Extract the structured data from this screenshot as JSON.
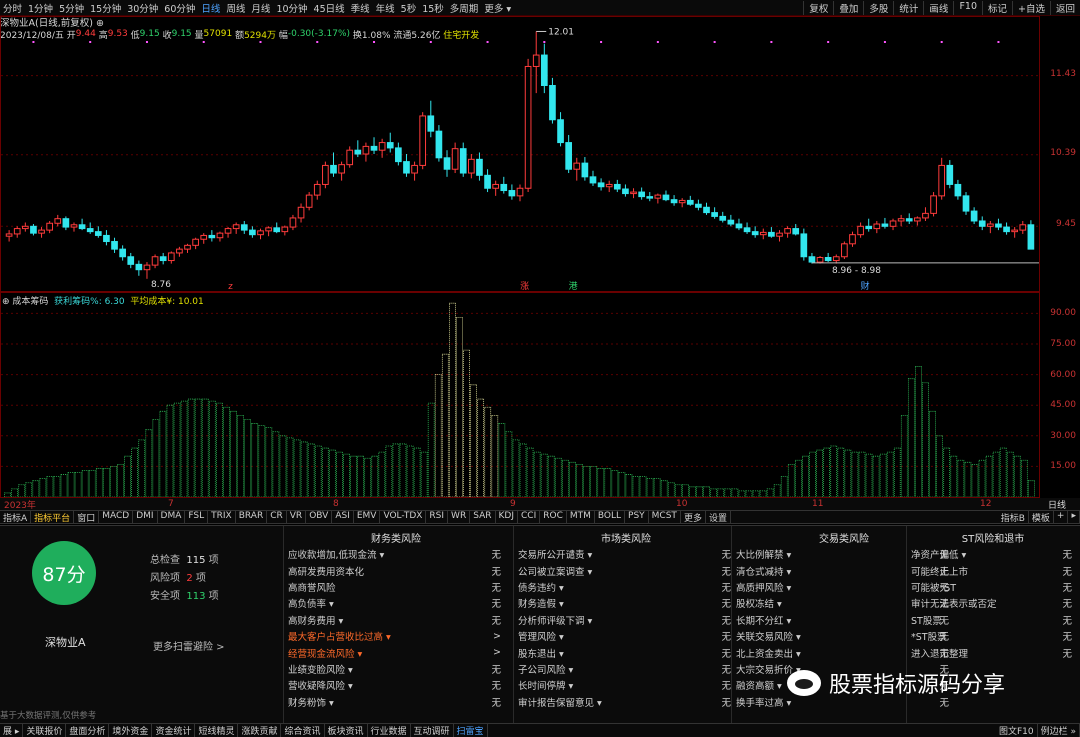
{
  "topbar": {
    "periods": [
      "分时",
      "1分钟",
      "5分钟",
      "15分钟",
      "30分钟",
      "60分钟",
      "日线",
      "周线",
      "月线",
      "10分钟",
      "45日线",
      "季线",
      "年线",
      "5秒",
      "15秒",
      "多周期",
      "更多 ▾"
    ],
    "active_index": 6,
    "tools": [
      "复权",
      "叠加",
      "多股",
      "统计",
      "画线",
      "F10",
      "标记",
      "+自选",
      "返回"
    ]
  },
  "info": {
    "title": "深物业A(日线,前复权) ⊕",
    "date": "2023/12/08/五",
    "open_label": "开",
    "open": "9.44",
    "high_label": "高",
    "high": "9.53",
    "low_label": "低",
    "low": "9.15",
    "close_label": "收",
    "close": "9.15",
    "vol_label": "量",
    "vol": "57091",
    "amount_label": "额",
    "amount": "5294万",
    "chg_label": "幅",
    "chg": "-0.30(-3.17%)",
    "turnover": "换1.08%",
    "float_cap": "流通5.26亿",
    "sector": "住宅开发"
  },
  "price_axis": [
    "11.43",
    "10.39",
    "9.45"
  ],
  "price_annotations": {
    "high": "12.01",
    "low": "8.76",
    "range": "8.96 - 8.98"
  },
  "markers": {
    "zhang": "涨",
    "gang": "港",
    "cai": "财",
    "z": "z"
  },
  "chip": {
    "title": "⊕ 成本筹码",
    "profit": "获利筹码%: 6.30",
    "avg_cost": "平均成本¥: 10.01",
    "axis": [
      "90.00",
      "75.00",
      "60.00",
      "45.00",
      "30.00",
      "15.00"
    ]
  },
  "time_axis": {
    "labels": [
      "2023年",
      "7",
      "8",
      "9",
      "10",
      "11",
      "12"
    ],
    "right": "日线"
  },
  "tabbar": {
    "items": [
      "指标A",
      "指标平台",
      "窗口",
      "MACD",
      "DMI",
      "DMA",
      "FSL",
      "TRIX",
      "BRAR",
      "CR",
      "VR",
      "OBV",
      "ASI",
      "EMV",
      "VOL-TDX",
      "RSI",
      "WR",
      "SAR",
      "KDJ",
      "CCI",
      "ROC",
      "MTM",
      "BOLL",
      "PSY",
      "MCST",
      "更多",
      "设置"
    ],
    "active_index": 1,
    "right": [
      "指标B",
      "模板",
      "+",
      "▸"
    ]
  },
  "risk": {
    "score": "87分",
    "stock_name": "深物业A",
    "total_label": "总检查",
    "total_value": "115",
    "unit": "项",
    "risk_label": "风险项",
    "risk_value": "2",
    "safe_label": "安全项",
    "safe_value": "113",
    "more_scan": "更多扫雷避险 >",
    "disclaimer": "基于大数据评测,仅供参考",
    "columns": [
      {
        "title": "财务类风险",
        "rows": [
          {
            "label": "应收款增加,低现金流 ▾",
            "value": "无"
          },
          {
            "label": "高研发费用资本化",
            "value": "无"
          },
          {
            "label": "高商誉风险",
            "value": "无"
          },
          {
            "label": "高负债率 ▾",
            "value": "无"
          },
          {
            "label": "高财务费用 ▾",
            "value": "无"
          },
          {
            "label": "最大客户占营收比过高 ▾",
            "value": ">",
            "hot": true
          },
          {
            "label": "经营现金流风险 ▾",
            "value": ">",
            "hot": true
          },
          {
            "label": "业绩变脸风险 ▾",
            "value": "无"
          },
          {
            "label": "营收疑降风险 ▾",
            "value": "无"
          },
          {
            "label": "财务粉饰 ▾",
            "value": "无"
          }
        ]
      },
      {
        "title": "市场类风险",
        "rows": [
          {
            "label": "交易所公开谴责 ▾",
            "value": "无"
          },
          {
            "label": "公司被立案调查 ▾",
            "value": "无"
          },
          {
            "label": "债务违约 ▾",
            "value": "无"
          },
          {
            "label": "财务造假 ▾",
            "value": "无"
          },
          {
            "label": "分析师评级下调 ▾",
            "value": "无"
          },
          {
            "label": "管理风险 ▾",
            "value": "无"
          },
          {
            "label": "股东退出 ▾",
            "value": "无"
          },
          {
            "label": "子公司风险 ▾",
            "value": "无"
          },
          {
            "label": "长时间停牌 ▾",
            "value": "无"
          },
          {
            "label": "审计报告保留意见 ▾",
            "value": "无"
          }
        ]
      },
      {
        "title": "交易类风险",
        "rows": [
          {
            "label": "大比例解禁 ▾",
            "value": "无"
          },
          {
            "label": "清仓式减持 ▾",
            "value": "无"
          },
          {
            "label": "高质押风险 ▾",
            "value": "无"
          },
          {
            "label": "股权冻结 ▾",
            "value": "无"
          },
          {
            "label": "长期不分红 ▾",
            "value": "无"
          },
          {
            "label": "关联交易风险 ▾",
            "value": "无"
          },
          {
            "label": "北上资金卖出 ▾",
            "value": "无"
          },
          {
            "label": "大宗交易折价 ▾",
            "value": "无"
          },
          {
            "label": "融资高额 ▾",
            "value": "无"
          },
          {
            "label": "换手率过高 ▾",
            "value": "无"
          }
        ]
      },
      {
        "title": "ST风险和退市",
        "rows": [
          {
            "label": "净资产偏低 ▾",
            "value": "无"
          },
          {
            "label": "可能终止上市",
            "value": "无"
          },
          {
            "label": "可能被*ST",
            "value": "无"
          },
          {
            "label": "审计无法表示或否定",
            "value": "无"
          },
          {
            "label": "ST股票",
            "value": "无"
          },
          {
            "label": "*ST股票",
            "value": "无"
          },
          {
            "label": "进入退市整理",
            "value": "无"
          }
        ]
      }
    ]
  },
  "watermark": "股票指标源码分享",
  "bottombar": {
    "items": [
      "展 ▸",
      "关联报价",
      "盘面分析",
      "境外资金",
      "资金统计",
      "短线精灵",
      "涨跌贡献",
      "综合资讯",
      "板块资讯",
      "行业数据",
      "互动调研",
      "扫雷宝"
    ],
    "active_index": 11,
    "right": [
      "图文F10",
      "例边栏 »"
    ]
  },
  "colors": {
    "up": "#ff3c3c",
    "down": "#32e6ee",
    "chip_old": "#2fc35a",
    "chip_new": "#e8e8a0",
    "score": "#1fae5c"
  },
  "chart_data": {
    "type": "candlestick",
    "ylim": [
      8.6,
      12.2
    ],
    "y_ticks": [
      11.43,
      10.39,
      9.45
    ],
    "ohlc": [
      [
        9.32,
        9.4,
        9.25,
        9.35
      ],
      [
        9.35,
        9.45,
        9.3,
        9.42
      ],
      [
        9.42,
        9.5,
        9.38,
        9.45
      ],
      [
        9.45,
        9.48,
        9.33,
        9.36
      ],
      [
        9.36,
        9.44,
        9.3,
        9.4
      ],
      [
        9.4,
        9.52,
        9.36,
        9.49
      ],
      [
        9.49,
        9.6,
        9.45,
        9.55
      ],
      [
        9.55,
        9.58,
        9.4,
        9.44
      ],
      [
        9.44,
        9.5,
        9.38,
        9.47
      ],
      [
        9.47,
        9.55,
        9.4,
        9.42
      ],
      [
        9.42,
        9.5,
        9.35,
        9.38
      ],
      [
        9.38,
        9.45,
        9.3,
        9.33
      ],
      [
        9.33,
        9.4,
        9.2,
        9.25
      ],
      [
        9.25,
        9.3,
        9.1,
        9.15
      ],
      [
        9.15,
        9.2,
        9.0,
        9.05
      ],
      [
        9.05,
        9.1,
        8.9,
        8.95
      ],
      [
        8.95,
        9.0,
        8.8,
        8.88
      ],
      [
        8.88,
        8.98,
        8.76,
        8.94
      ],
      [
        8.94,
        9.08,
        8.9,
        9.05
      ],
      [
        9.05,
        9.1,
        8.95,
        9.0
      ],
      [
        9.0,
        9.12,
        8.96,
        9.1
      ],
      [
        9.1,
        9.18,
        9.05,
        9.15
      ],
      [
        9.15,
        9.22,
        9.1,
        9.2
      ],
      [
        9.2,
        9.3,
        9.15,
        9.28
      ],
      [
        9.28,
        9.36,
        9.22,
        9.33
      ],
      [
        9.33,
        9.4,
        9.25,
        9.3
      ],
      [
        9.3,
        9.38,
        9.25,
        9.36
      ],
      [
        9.36,
        9.44,
        9.3,
        9.42
      ],
      [
        9.42,
        9.5,
        9.35,
        9.47
      ],
      [
        9.47,
        9.52,
        9.35,
        9.4
      ],
      [
        9.4,
        9.45,
        9.3,
        9.34
      ],
      [
        9.34,
        9.42,
        9.28,
        9.39
      ],
      [
        9.39,
        9.45,
        9.32,
        9.43
      ],
      [
        9.43,
        9.5,
        9.36,
        9.38
      ],
      [
        9.38,
        9.46,
        9.33,
        9.44
      ],
      [
        9.44,
        9.6,
        9.4,
        9.56
      ],
      [
        9.56,
        9.75,
        9.5,
        9.7
      ],
      [
        9.7,
        9.9,
        9.66,
        9.86
      ],
      [
        9.86,
        10.05,
        9.8,
        10.0
      ],
      [
        10.0,
        10.3,
        9.95,
        10.25
      ],
      [
        10.25,
        10.42,
        10.1,
        10.15
      ],
      [
        10.15,
        10.3,
        10.05,
        10.26
      ],
      [
        10.26,
        10.5,
        10.22,
        10.45
      ],
      [
        10.45,
        10.58,
        10.36,
        10.4
      ],
      [
        10.4,
        10.55,
        10.3,
        10.5
      ],
      [
        10.5,
        10.62,
        10.4,
        10.45
      ],
      [
        10.45,
        10.6,
        10.35,
        10.55
      ],
      [
        10.55,
        10.68,
        10.42,
        10.48
      ],
      [
        10.48,
        10.55,
        10.25,
        10.3
      ],
      [
        10.3,
        10.4,
        10.1,
        10.15
      ],
      [
        10.15,
        10.3,
        10.05,
        10.25
      ],
      [
        10.25,
        10.95,
        10.2,
        10.9
      ],
      [
        10.9,
        11.1,
        10.62,
        10.7
      ],
      [
        10.7,
        10.78,
        10.3,
        10.35
      ],
      [
        10.35,
        10.45,
        10.1,
        10.2
      ],
      [
        10.2,
        10.55,
        10.15,
        10.47
      ],
      [
        10.47,
        10.55,
        10.1,
        10.15
      ],
      [
        10.15,
        10.4,
        10.08,
        10.33
      ],
      [
        10.33,
        10.42,
        10.05,
        10.12
      ],
      [
        10.12,
        10.2,
        9.9,
        9.95
      ],
      [
        9.95,
        10.05,
        9.85,
        10.0
      ],
      [
        10.0,
        10.1,
        9.88,
        9.92
      ],
      [
        9.92,
        10.0,
        9.8,
        9.85
      ],
      [
        9.85,
        10.0,
        9.78,
        9.95
      ],
      [
        9.95,
        11.65,
        9.9,
        11.55
      ],
      [
        11.55,
        12.01,
        11.2,
        11.7
      ],
      [
        11.7,
        11.85,
        11.2,
        11.3
      ],
      [
        11.3,
        11.4,
        10.8,
        10.85
      ],
      [
        10.85,
        10.95,
        10.5,
        10.55
      ],
      [
        10.55,
        10.65,
        10.15,
        10.2
      ],
      [
        10.2,
        10.35,
        10.05,
        10.28
      ],
      [
        10.28,
        10.36,
        10.05,
        10.1
      ],
      [
        10.1,
        10.18,
        9.98,
        10.02
      ],
      [
        10.02,
        10.08,
        9.92,
        9.97
      ],
      [
        9.97,
        10.05,
        9.9,
        10.0
      ],
      [
        10.0,
        10.06,
        9.9,
        9.94
      ],
      [
        9.94,
        10.0,
        9.84,
        9.88
      ],
      [
        9.88,
        9.95,
        9.82,
        9.9
      ],
      [
        9.9,
        9.96,
        9.8,
        9.84
      ],
      [
        9.84,
        9.9,
        9.78,
        9.82
      ],
      [
        9.82,
        9.88,
        9.75,
        9.86
      ],
      [
        9.86,
        9.92,
        9.78,
        9.8
      ],
      [
        9.8,
        9.86,
        9.72,
        9.76
      ],
      [
        9.76,
        9.82,
        9.7,
        9.79
      ],
      [
        9.79,
        9.85,
        9.72,
        9.74
      ],
      [
        9.74,
        9.8,
        9.66,
        9.7
      ],
      [
        9.7,
        9.76,
        9.6,
        9.63
      ],
      [
        9.63,
        9.7,
        9.55,
        9.58
      ],
      [
        9.58,
        9.64,
        9.5,
        9.53
      ],
      [
        9.53,
        9.6,
        9.45,
        9.48
      ],
      [
        9.48,
        9.55,
        9.4,
        9.43
      ],
      [
        9.43,
        9.5,
        9.35,
        9.38
      ],
      [
        9.38,
        9.45,
        9.3,
        9.34
      ],
      [
        9.34,
        9.42,
        9.28,
        9.37
      ],
      [
        9.37,
        9.44,
        9.3,
        9.32
      ],
      [
        9.32,
        9.4,
        9.25,
        9.36
      ],
      [
        9.36,
        9.45,
        9.3,
        9.42
      ],
      [
        9.42,
        9.48,
        9.33,
        9.35
      ],
      [
        9.35,
        9.42,
        9.0,
        9.05
      ],
      [
        9.05,
        9.1,
        8.96,
        8.98
      ],
      [
        8.98,
        9.06,
        8.96,
        9.04
      ],
      [
        9.04,
        9.1,
        8.98,
        9.0
      ],
      [
        9.0,
        9.08,
        8.96,
        9.05
      ],
      [
        9.05,
        9.25,
        9.02,
        9.22
      ],
      [
        9.22,
        9.38,
        9.18,
        9.34
      ],
      [
        9.34,
        9.5,
        9.3,
        9.45
      ],
      [
        9.45,
        9.55,
        9.38,
        9.42
      ],
      [
        9.42,
        9.52,
        9.36,
        9.48
      ],
      [
        9.48,
        9.56,
        9.42,
        9.45
      ],
      [
        9.45,
        9.55,
        9.4,
        9.52
      ],
      [
        9.52,
        9.6,
        9.45,
        9.55
      ],
      [
        9.55,
        9.62,
        9.48,
        9.52
      ],
      [
        9.52,
        9.58,
        9.46,
        9.56
      ],
      [
        9.56,
        9.7,
        9.52,
        9.62
      ],
      [
        9.62,
        9.9,
        9.58,
        9.85
      ],
      [
        9.85,
        10.35,
        9.8,
        10.25
      ],
      [
        10.25,
        10.32,
        9.95,
        10.0
      ],
      [
        10.0,
        10.06,
        9.8,
        9.85
      ],
      [
        9.85,
        9.9,
        9.6,
        9.65
      ],
      [
        9.65,
        9.7,
        9.48,
        9.52
      ],
      [
        9.52,
        9.58,
        9.4,
        9.45
      ],
      [
        9.45,
        9.52,
        9.36,
        9.48
      ],
      [
        9.48,
        9.55,
        9.4,
        9.44
      ],
      [
        9.44,
        9.5,
        9.34,
        9.38
      ],
      [
        9.38,
        9.44,
        9.3,
        9.4
      ],
      [
        9.4,
        9.52,
        9.35,
        9.47
      ],
      [
        9.47,
        9.53,
        9.15,
        9.15
      ]
    ],
    "chip_bars": [
      2,
      4,
      6,
      7,
      8,
      9,
      10,
      10,
      11,
      12,
      12,
      13,
      13,
      14,
      14,
      15,
      16,
      20,
      24,
      28,
      33,
      38,
      42,
      45,
      46,
      47,
      48,
      48,
      48,
      47,
      46,
      44,
      42,
      40,
      38,
      36,
      35,
      34,
      32,
      30,
      29,
      28,
      27,
      26,
      25,
      24,
      23,
      22,
      21,
      20,
      20,
      19,
      20,
      22,
      25,
      26,
      26,
      25,
      24,
      22,
      46,
      60,
      70,
      95,
      88,
      72,
      55,
      48,
      44,
      40,
      36,
      32,
      28,
      26,
      24,
      22,
      21,
      20,
      19,
      18,
      17,
      16,
      15,
      15,
      14,
      14,
      13,
      12,
      11,
      10,
      10,
      9,
      9,
      8,
      7,
      6,
      6,
      5,
      5,
      5,
      4,
      4,
      4,
      4,
      3,
      3,
      3,
      3,
      4,
      6,
      10,
      16,
      18,
      20,
      22,
      23,
      24,
      25,
      24,
      23,
      22,
      22,
      21,
      20,
      21,
      22,
      24,
      40,
      58,
      64,
      56,
      42,
      30,
      24,
      20,
      18,
      17,
      16,
      18,
      20,
      22,
      24,
      22,
      20,
      18,
      8
    ]
  }
}
